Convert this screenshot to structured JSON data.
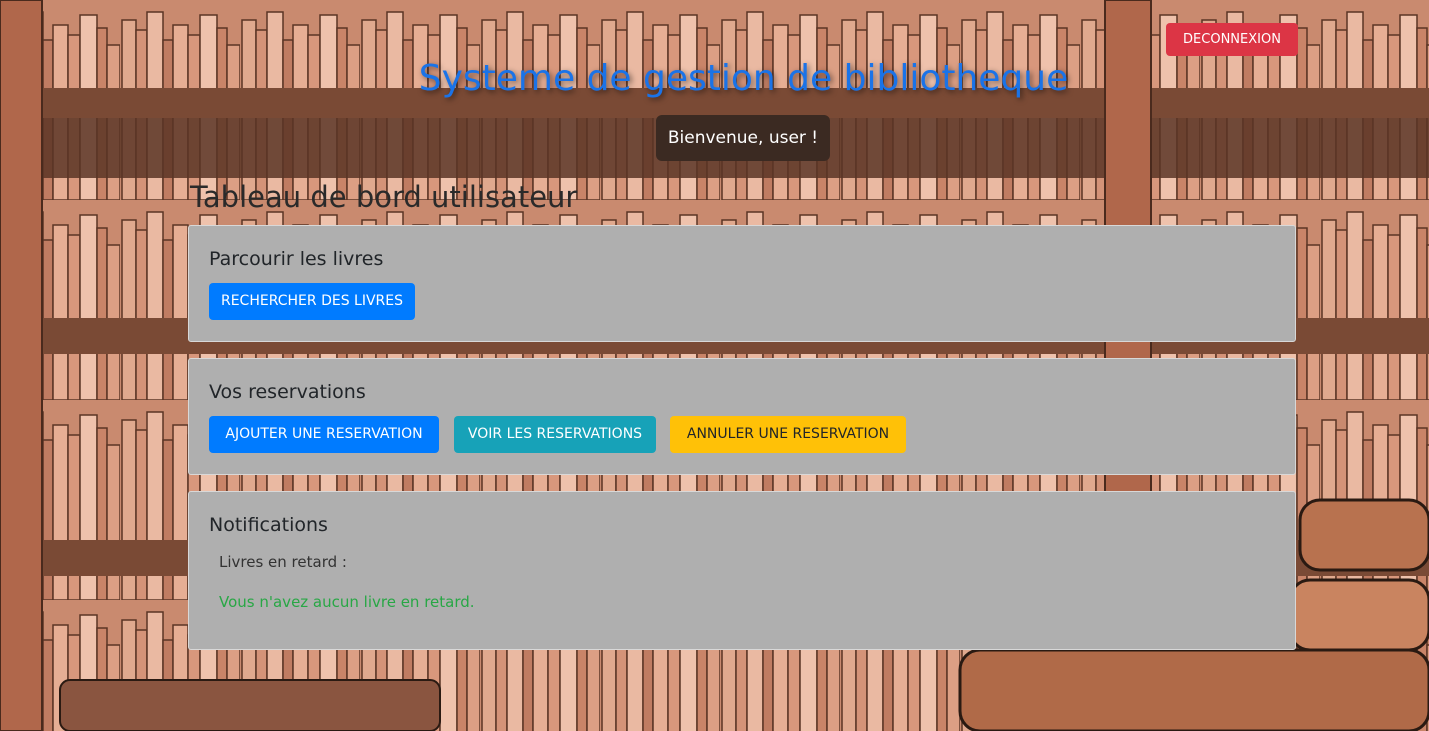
{
  "header": {
    "logout_label": "DECONNEXION",
    "app_title": "Systeme de gestion de bibliotheque",
    "welcome": "Bienvenue, user !"
  },
  "dashboard": {
    "title": "Tableau de bord utilisateur"
  },
  "cards": {
    "books": {
      "title": "Parcourir les livres",
      "search_label": "RECHERCHER DES LIVRES"
    },
    "reservations": {
      "title": "Vos reservations",
      "add_label": "AJOUTER UNE RESERVATION",
      "view_label": "VOIR LES RESERVATIONS",
      "cancel_label": "ANNULER UNE RESERVATION"
    },
    "notifications": {
      "title": "Notifications",
      "overdue_label": "Livres en retard :",
      "overdue_status": "Vous n'avez aucun livre en retard."
    }
  },
  "colors": {
    "accent_blue": "#007bff",
    "title_blue": "#1a73e8",
    "danger": "#dc3545",
    "info": "#17a2b8",
    "warning": "#ffc107",
    "success": "#28a745",
    "card_bg": "#afafaf"
  },
  "icons": {
    "background": "bookshelf-illustration"
  }
}
